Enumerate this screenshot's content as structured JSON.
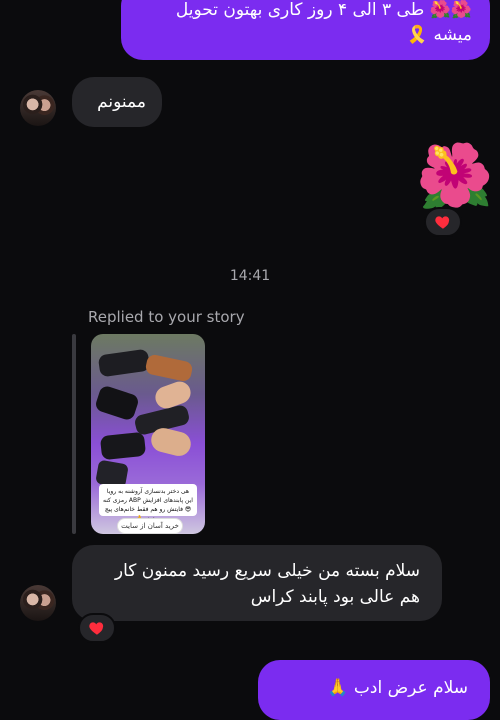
{
  "messages": {
    "outgoing_1": {
      "line1": "طی ۳ الی ۴ روز کاری بهتون تحویل",
      "line2": "میشه",
      "emoji_start": "🌺🌺",
      "emoji_end": "🎗️"
    },
    "incoming_1": {
      "text": "ممنونم"
    },
    "sticker": {
      "emoji": "🌺"
    },
    "timestamp": "14:41",
    "story_reply": {
      "label": "Replied to your story",
      "caption": "هی دختر بدنسازی آروشنه به رویا این پابندهای افزایش ABP رمزی کنه😎 فایتش رو هم فقط خانم‌های پیچ میدونن👌",
      "button": "خرید آسان از سایت 🔗"
    },
    "incoming_2": {
      "line1": "سلام بسته من خیلی سریع رسید ممنون کار",
      "line2": "هم عالی بود پابند کراس"
    },
    "outgoing_2": {
      "text": "سلام عرض ادب 🙏"
    }
  },
  "reactions": {
    "heart": "❤️"
  },
  "colors": {
    "outgoing_bubble": "#7b2cf0",
    "incoming_bubble": "#26262a",
    "background": "#0b0b0d"
  }
}
